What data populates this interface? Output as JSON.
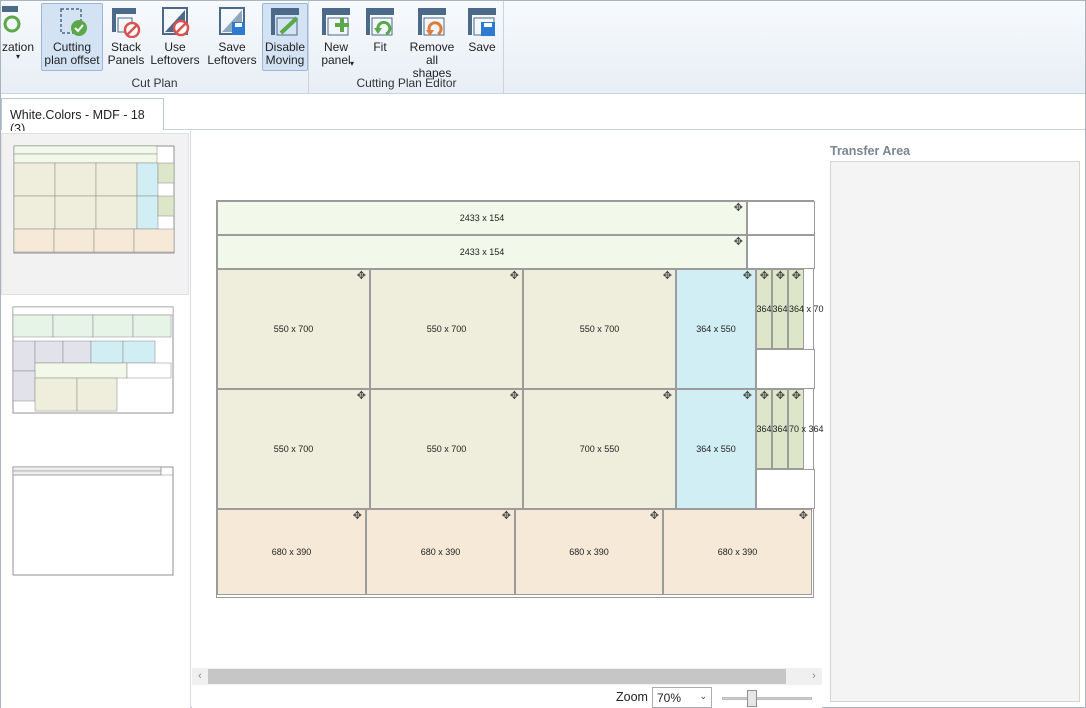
{
  "ribbon": {
    "groups": [
      {
        "label": "Cut Plan"
      },
      {
        "label": "Cutting Plan Editor"
      }
    ],
    "buttons": {
      "optimization": "zation",
      "cutting_plan_offset": "Cutting\nplan offset",
      "stack_panels": "Stack\nPanels",
      "use_leftovers": "Use\nLeftovers",
      "save_leftovers": "Save\nLeftovers",
      "disable_moving": "Disable\nMoving",
      "new_panel": "New\npanel",
      "fit": "Fit",
      "remove_all_shapes": "Remove\nall shapes",
      "save": "Save"
    }
  },
  "tab": {
    "label": "White.Colors - MDF - 18 (3)"
  },
  "pieces": {
    "strip1": "2433 x 154",
    "strip2": "2433 x 154",
    "r1c1": "550 x 700",
    "r1c2": "550 x 700",
    "r1c3": "550 x 700",
    "r1c4": "364 x 550",
    "r1s1": "364",
    "r1s2": "364",
    "r1s3": "364 x 70",
    "r2c1": "550 x 700",
    "r2c2": "550 x 700",
    "r2c3": "700 x 550",
    "r2c4": "364 x 550",
    "r2s1": "364",
    "r2s2": "364",
    "r2s3": "70 x 364",
    "p1": "680 x 390",
    "p2": "680 x 390",
    "p3": "680 x 390",
    "p4": "680 x 390"
  },
  "zoom": {
    "label": "Zoom",
    "value": "70%",
    "slider_fraction": 0.3
  },
  "transfer": {
    "title": "Transfer Area"
  },
  "colors": {
    "accent_green": "#5aa84a",
    "ribbon_icon": "#4b6a8a",
    "stop_red": "#d9534f"
  }
}
